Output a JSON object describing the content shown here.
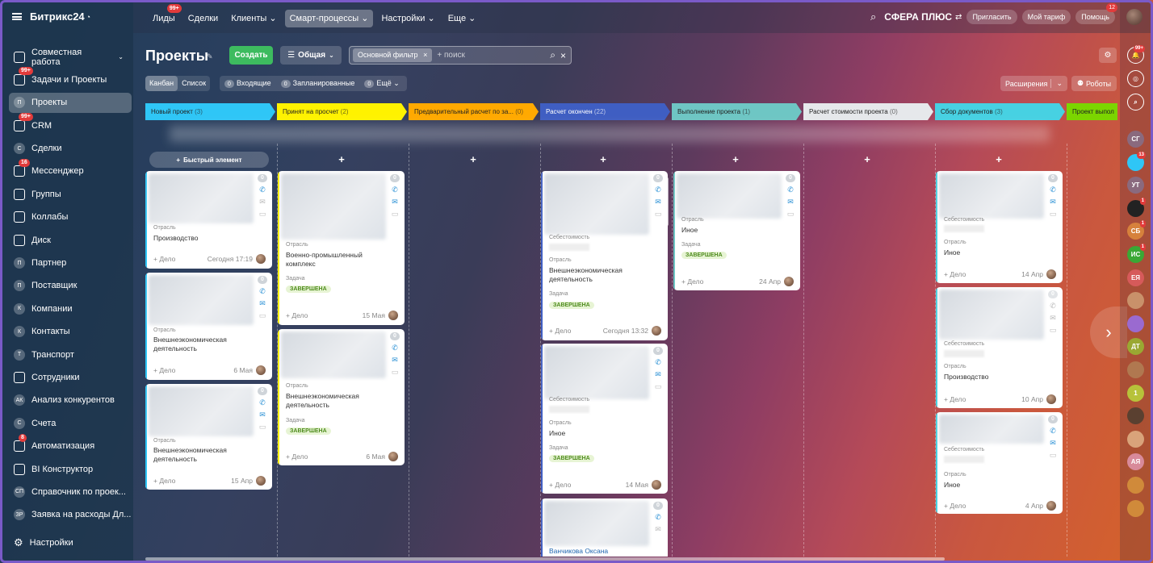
{
  "app": {
    "logo": "Битрикс24",
    "company": "СФЕРА ПЛЮС"
  },
  "topnav": [
    {
      "label": "Лиды",
      "badge": "99+"
    },
    {
      "label": "Сделки"
    },
    {
      "label": "Клиенты ⌄"
    },
    {
      "label": "Смарт-процессы ⌄"
    },
    {
      "label": "Настройки ⌄"
    },
    {
      "label": "Еще ⌄"
    }
  ],
  "top_actions": {
    "invite": "Пригласить",
    "tariff": "Мой тариф",
    "help": "Помощь",
    "help_badge": "12"
  },
  "sidebar": {
    "items": [
      {
        "label": "Совместная работа",
        "icon": "puzzle-icon"
      },
      {
        "label": "Задачи и Проекты",
        "badge": "99+",
        "icon": "tasks-icon"
      },
      {
        "label": "Проекты",
        "ic": "П"
      },
      {
        "label": "CRM",
        "badge": "99+",
        "icon": "crm-icon"
      },
      {
        "label": "Сделки",
        "ic": "С"
      },
      {
        "label": "Мессенджер",
        "badge": "16",
        "icon": "chat-icon"
      },
      {
        "label": "Группы",
        "icon": "groups-icon"
      },
      {
        "label": "Коллабы",
        "icon": "collab-icon"
      },
      {
        "label": "Диск",
        "icon": "disk-icon"
      },
      {
        "label": "Партнер",
        "ic": "П"
      },
      {
        "label": "Поставщик",
        "ic": "П"
      },
      {
        "label": "Компании",
        "ic": "К"
      },
      {
        "label": "Контакты",
        "ic": "К"
      },
      {
        "label": "Транспорт",
        "ic": "Т"
      },
      {
        "label": "Сотрудники",
        "icon": "employees-icon"
      },
      {
        "label": "Анализ конкурентов",
        "ic": "АК"
      },
      {
        "label": "Счета",
        "ic": "С"
      },
      {
        "label": "Автоматизация",
        "badge": "8",
        "icon": "automation-icon"
      },
      {
        "label": "BI Конструктор",
        "icon": "bi-icon"
      },
      {
        "label": "Справочник по проек...",
        "ic": "СП"
      },
      {
        "label": "Заявка на расходы Дл...",
        "ic": "ЗР"
      }
    ],
    "settings": "Настройки"
  },
  "header": {
    "title": "Проекты",
    "create": "Создать",
    "general": "Общая",
    "filter_tag": "Основной фильтр",
    "search_placeholder": "+ поиск"
  },
  "toolbar": {
    "kanban": "Канбан",
    "list": "Список",
    "incoming_count": "0",
    "incoming": "Входящие",
    "planned_count": "0",
    "planned": "Запланированные",
    "more_count": "0",
    "more": "Ещё",
    "extensions": "Расширения",
    "robots": "Роботы"
  },
  "stages": [
    {
      "name": "Новый проект",
      "count": "(3)",
      "color": "#2fc6f6"
    },
    {
      "name": "Принят на просчет",
      "count": "(2)",
      "color": "#fff200"
    },
    {
      "name": "Предварительный расчет по за...",
      "count": "(0)",
      "color": "#ffa900"
    },
    {
      "name": "Расчет окончен",
      "count": "(22)",
      "color": "#3f5ec2"
    },
    {
      "name": "Выполнение проекта",
      "count": "(1)",
      "color": "#6ec6c4"
    },
    {
      "name": "Расчет стоимости проекта",
      "count": "(0)",
      "color": "#e6e8eb"
    },
    {
      "name": "Сбор документов",
      "count": "(3)",
      "color": "#47d1e2"
    },
    {
      "name": "Проект выпол",
      "count": "",
      "color": "#7bd500"
    }
  ],
  "quick_add": "Быстрый элемент",
  "labels": {
    "industry": "Отрасль",
    "task": "Задача",
    "cost": "Себестоимость",
    "deal": "+ Дело",
    "done": "ЗАВЕРШЕНА",
    "counter": "0"
  },
  "cards": {
    "c1": {
      "industry": "Производство",
      "date": "Сегодня 17:19"
    },
    "c2": {
      "industry": "Внешнеэкономическая деятельность",
      "date": "6 Мая"
    },
    "c3": {
      "industry": "Внешнеэкономическая деятельность",
      "date": "15 Апр"
    },
    "c4": {
      "industry": "Военно-промышленный комплекс",
      "date": "15 Мая"
    },
    "c5": {
      "industry": "Внешнеэкономическая деятельность",
      "date": "6 Мая"
    },
    "c6": {
      "industry": "Внешнеэкономическая деятельность",
      "date": "Сегодня 13:32"
    },
    "c7": {
      "industry": "Иное",
      "date": "14 Мая"
    },
    "c8": {
      "name": "Ванчикова Оксана"
    },
    "c9": {
      "industry": "Иное",
      "date": "24 Апр"
    },
    "c10": {
      "industry": "Иное",
      "date": "14 Апр"
    },
    "c11": {
      "industry": "Производство",
      "date": "10 Апр"
    },
    "c12": {
      "industry": "Иное",
      "date": "4 Апр"
    }
  },
  "rail": [
    {
      "label": "СГ",
      "color": "#8a6a7e"
    },
    {
      "label": "",
      "color": "#2fc6f6",
      "badge": "13"
    },
    {
      "label": "УТ",
      "color": "#8a6a7e"
    },
    {
      "label": "",
      "color": "#222",
      "badge": "1"
    },
    {
      "label": "СБ",
      "color": "#d6813c",
      "badge": "1"
    },
    {
      "label": "ИС",
      "color": "#3aa835",
      "badge": "1"
    },
    {
      "label": "ЕЯ",
      "color": "#d65a5a"
    },
    {
      "label": "",
      "color": "#c9916a"
    },
    {
      "label": "",
      "color": "#9a6ad0"
    },
    {
      "label": "ДТ",
      "color": "#9aa832"
    },
    {
      "label": "",
      "color": "#b07850"
    },
    {
      "label": "1",
      "color": "#b7c23a"
    },
    {
      "label": "",
      "color": "#5a4030"
    },
    {
      "label": "",
      "color": "#d9a37a"
    },
    {
      "label": "АЯ",
      "color": "#d88a9a"
    },
    {
      "label": "",
      "color": "#d08a3a"
    },
    {
      "label": "",
      "color": "#d08a3a"
    }
  ]
}
